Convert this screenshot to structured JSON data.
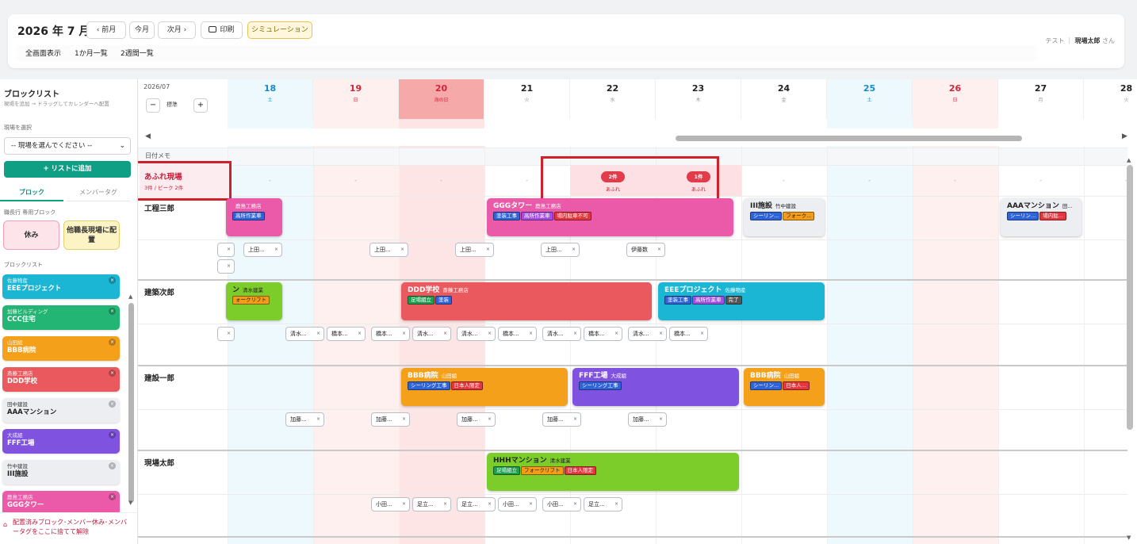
{
  "header": {
    "title": "2026 年 7 月",
    "prev": "‹ 前月",
    "today": "今月",
    "next": "次月 ›",
    "print": "印刷",
    "simulation": "シミュレーション",
    "view_tabs": [
      "全画面表示",
      "1か月一覧",
      "2週間一覧"
    ],
    "user_prefix": "テスト",
    "user_name": "現場太郎",
    "user_suffix": "さん"
  },
  "sidebar": {
    "title": "ブロックリスト",
    "subtitle": "現場を追加 → ドラッグしてカレンダーへ配置",
    "select_label": "現場を選択",
    "select_placeholder": "-- 現場を選んでください --",
    "add_button": "+ リストに追加",
    "tabs": [
      "ブロック",
      "メンバータグ"
    ],
    "special_label": "職長行 専用ブロック",
    "special": [
      "休み",
      "他職長現場に配置"
    ],
    "list_label": "ブロックリスト",
    "blocks": [
      {
        "company": "佐藤物産",
        "name": "EEEプロジェクト",
        "color": "#1ab6d3"
      },
      {
        "company": "加藤ビルディング",
        "name": "CCC住宅",
        "color": "#22b573"
      },
      {
        "company": "山田組",
        "name": "BBB病院",
        "color": "#f5a01a"
      },
      {
        "company": "斎藤工務店",
        "name": "DDD学校",
        "color": "#e9595e"
      },
      {
        "company": "田中建設",
        "name": "AAAマンション",
        "color": "#eceef2"
      },
      {
        "company": "大成組",
        "name": "FFF工場",
        "color": "#8052e0"
      },
      {
        "company": "竹中建設",
        "name": "III施設",
        "color": "#eceef2"
      },
      {
        "company": "鹿島工務店",
        "name": "GGGタワー",
        "color": "#ea5aa8"
      }
    ],
    "drop_zone": "配置済みブロック･メンバー休み･メンバータグをここに捨てて解除"
  },
  "calendar": {
    "month_label": "2026/07",
    "zoom_label": "標準",
    "zoom_minus": "−",
    "zoom_plus": "+",
    "days": [
      {
        "n": "18",
        "w": "土",
        "type": "sat"
      },
      {
        "n": "19",
        "w": "日",
        "type": "sun"
      },
      {
        "n": "20",
        "w": "海の日",
        "type": "hol"
      },
      {
        "n": "21",
        "w": "火",
        "type": "wk"
      },
      {
        "n": "22",
        "w": "水",
        "type": "wk"
      },
      {
        "n": "23",
        "w": "木",
        "type": "wk"
      },
      {
        "n": "24",
        "w": "金",
        "type": "wk"
      },
      {
        "n": "25",
        "w": "土",
        "type": "sat"
      },
      {
        "n": "26",
        "w": "日",
        "type": "sun"
      },
      {
        "n": "27",
        "w": "月",
        "type": "wk"
      },
      {
        "n": "28",
        "w": "火",
        "type": "wk"
      }
    ],
    "memo_label": "日付メモ",
    "overflow": {
      "title": "あふれ現場",
      "sub": "3件 / ピーク 2件",
      "badges": [
        {
          "count": "2件",
          "label": "あふれ"
        },
        {
          "count": "1件",
          "label": "あふれ"
        }
      ]
    },
    "rows": [
      {
        "name": "工程三郎",
        "cards": [
          {
            "title": "",
            "company": "鹿島工務店",
            "tags": [
              {
                "t": "高所作業車",
                "c": "tg-b"
              }
            ]
          },
          {
            "title": "GGGタワー",
            "company": "鹿島工務店",
            "tags": [
              {
                "t": "塗装工事",
                "c": "tg-b"
              },
              {
                "t": "高所作業車",
                "c": "tg-p"
              },
              {
                "t": "場内駐車不可",
                "c": "tg-r"
              }
            ]
          },
          {
            "title": "III施設",
            "company": "竹中建設",
            "tags": [
              {
                "t": "シーリン...",
                "c": "tg-b"
              },
              {
                "t": "フォーク...",
                "c": "tg-o"
              }
            ]
          },
          {
            "title": "AAAマンション",
            "company": "田...",
            "tags": [
              {
                "t": "シーリン...",
                "c": "tg-b"
              },
              {
                "t": "場内駐...",
                "c": "tg-r"
              }
            ]
          }
        ],
        "pills": [
          "",
          "上田...",
          "",
          "上田...",
          "上田...",
          "上田...",
          "伊藤数"
        ]
      },
      {
        "name": "建築次郎",
        "cards": [
          {
            "title": "ン",
            "company": "清水建業",
            "tags": [
              {
                "t": "ォークリフト",
                "c": "tg-o"
              }
            ]
          },
          {
            "title": "DDD学校",
            "company": "斎藤工務店",
            "tags": [
              {
                "t": "足場組立",
                "c": "tg-g"
              },
              {
                "t": "塗装",
                "c": "tg-b"
              }
            ]
          },
          {
            "title": "EEEプロジェクト",
            "company": "佐藤物産",
            "tags": [
              {
                "t": "塗装工事",
                "c": "tg-b"
              },
              {
                "t": "高所作業車",
                "c": "tg-p"
              },
              {
                "t": "完了",
                "c": "tg-k"
              }
            ]
          }
        ],
        "pills": [
          "",
          "清水...",
          "橋本...",
          "橋本...",
          "清水...",
          "清水...",
          "橋本...",
          "清水...",
          "橋本...",
          "清水...",
          "橋本..."
        ]
      },
      {
        "name": "建設一郎",
        "cards": [
          {
            "title": "BBB病院",
            "company": "山田組",
            "tags": [
              {
                "t": "シーリング工事",
                "c": "tg-b"
              },
              {
                "t": "日本人限定",
                "c": "tg-r"
              }
            ]
          },
          {
            "title": "FFF工場",
            "company": "大成組",
            "tags": [
              {
                "t": "シーリング工事",
                "c": "tg-b"
              }
            ]
          },
          {
            "title": "BBB病院",
            "company": "山田組",
            "tags": [
              {
                "t": "シーリン...",
                "c": "tg-b"
              },
              {
                "t": "日本人...",
                "c": "tg-r"
              }
            ]
          }
        ],
        "pills": [
          "加藤...",
          "加藤...",
          "加藤...",
          "加藤...",
          "加藤..."
        ]
      },
      {
        "name": "現場太郎",
        "cards": [
          {
            "title": "HHHマンション",
            "company": "清水建業",
            "tags": [
              {
                "t": "足場組立",
                "c": "tg-g"
              },
              {
                "t": "フォークリフト",
                "c": "tg-o"
              },
              {
                "t": "日本人限定",
                "c": "tg-r"
              }
            ]
          }
        ],
        "pills": [
          "小田...",
          "足立...",
          "足立...",
          "小田...",
          "小田...",
          "足立..."
        ]
      }
    ]
  }
}
